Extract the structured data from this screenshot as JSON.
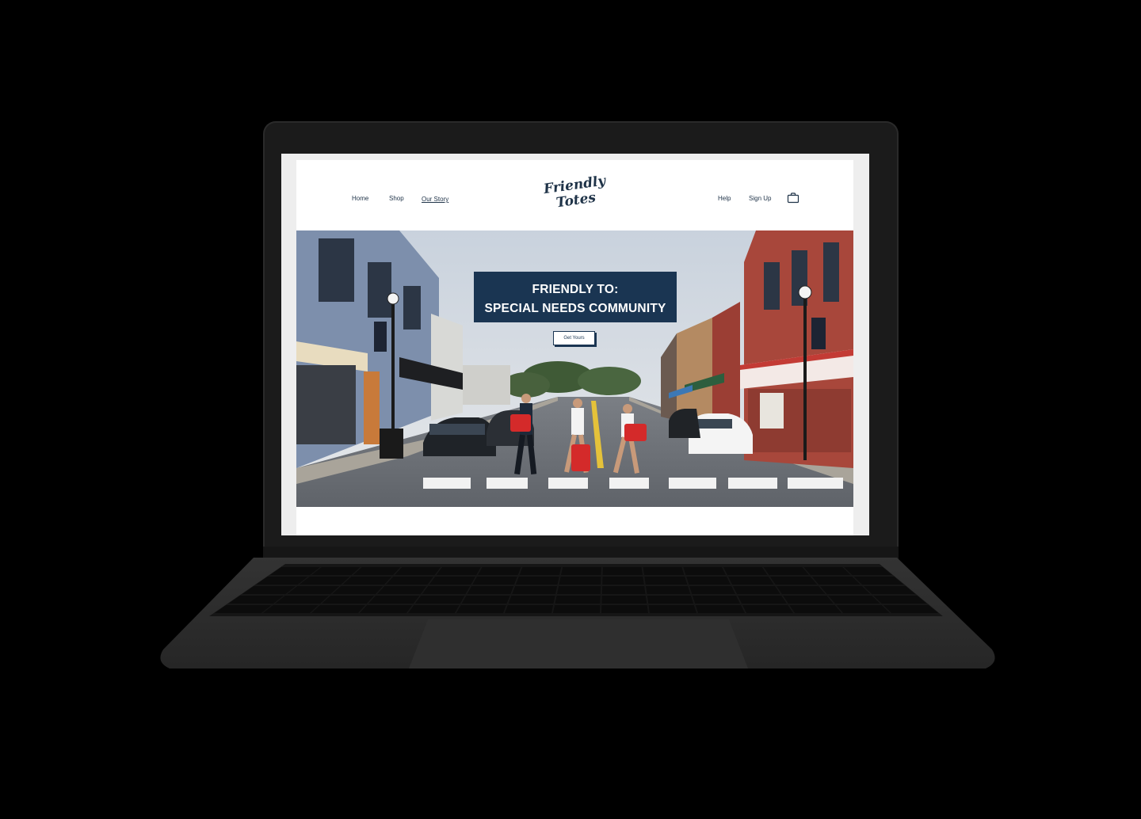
{
  "site": {
    "logo": {
      "line1": "Friendly",
      "line2": "Totes"
    },
    "nav_left": [
      {
        "label": "Home",
        "active": false
      },
      {
        "label": "Shop",
        "active": false
      },
      {
        "label": "Our Story",
        "active": true
      }
    ],
    "nav_right": [
      {
        "label": "Help"
      },
      {
        "label": "Sign Up"
      }
    ],
    "cart_icon": "shopping-bag-icon"
  },
  "hero": {
    "headline_line1": "FRIENDLY TO:",
    "headline_line2": "SPECIAL NEEDS COMMUNITY",
    "cta_label": "Get Yours"
  },
  "colors": {
    "brand_navy": "#1a3552",
    "tote_red": "#d42a2a",
    "laptop": "#1b1b1b"
  }
}
